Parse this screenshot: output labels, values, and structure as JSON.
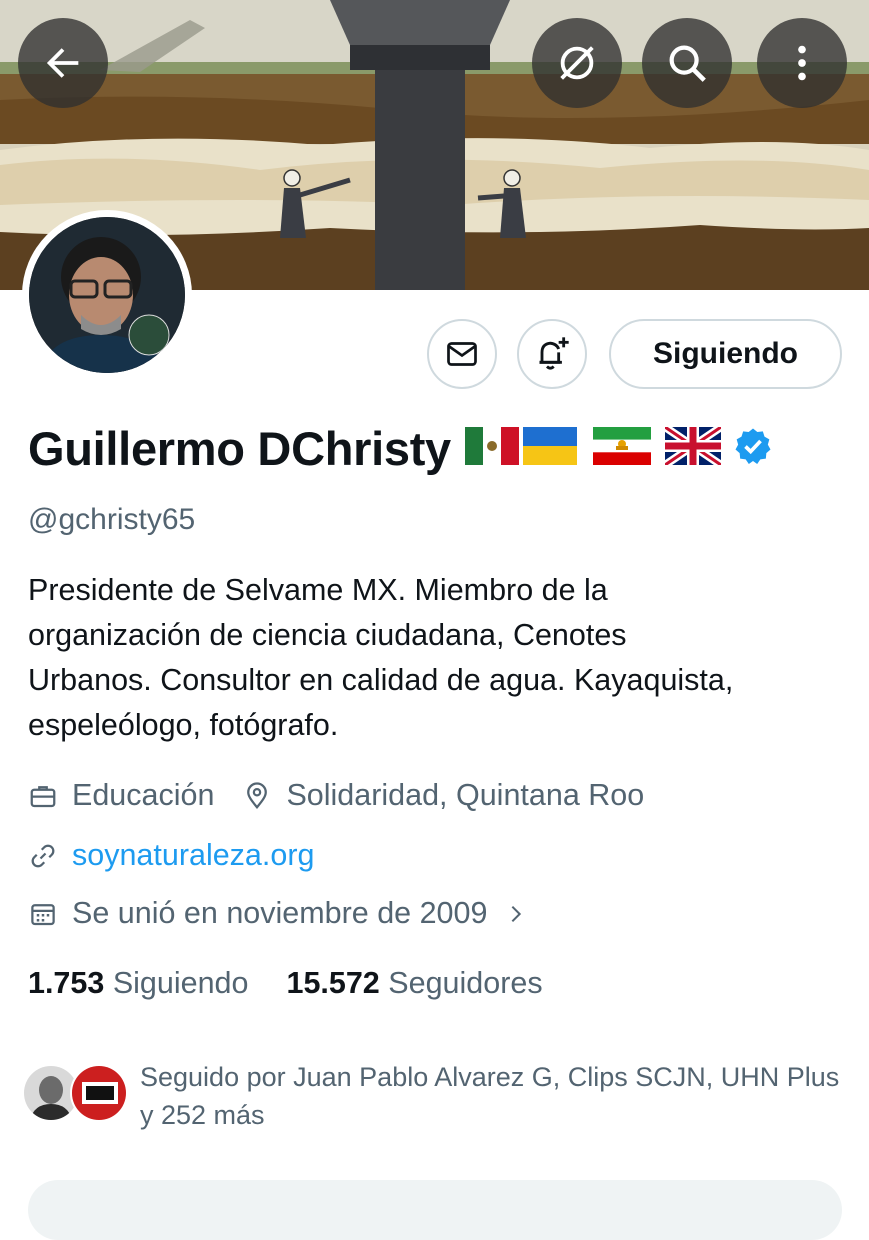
{
  "header": {
    "back_icon": "arrow-left-icon",
    "hide_icon": "no-preview-icon",
    "search_icon": "search-icon",
    "more_icon": "more-vertical-icon"
  },
  "profile": {
    "display_name": "Guillermo DChristy",
    "flags": [
      "mexico-flag",
      "ukraine-flag",
      "iran-lion-sun-flag",
      "uk-flag"
    ],
    "verified": true,
    "handle": "@gchristy65",
    "bio_lines": [
      "Presidente de Selvame MX. Miembro de la",
      "organización de ciencia ciudadana, Cenotes",
      "Urbanos. Consultor en calidad de agua. Kayaquista,",
      "espeleólogo, fotógrafo."
    ],
    "category": "Educación",
    "location": "Solidaridad, Quintana Roo",
    "website": "soynaturaleza.org",
    "joined": "Se unió en noviembre de 2009",
    "following_count": "1.753",
    "following_label": "Siguiendo",
    "followers_count": "15.572",
    "followers_label": "Seguidores"
  },
  "actions": {
    "message_icon": "envelope-icon",
    "notify_icon": "bell-plus-icon",
    "follow_label": "Siguiendo"
  },
  "followed_by": {
    "text": "Seguido por Juan Pablo Alvarez G, Clips SCJN, UHN Plus y 252 más"
  },
  "colors": {
    "accent": "#1d9bf0",
    "text": "#0f1419",
    "secondary": "#536471",
    "border": "#cfd9de"
  }
}
